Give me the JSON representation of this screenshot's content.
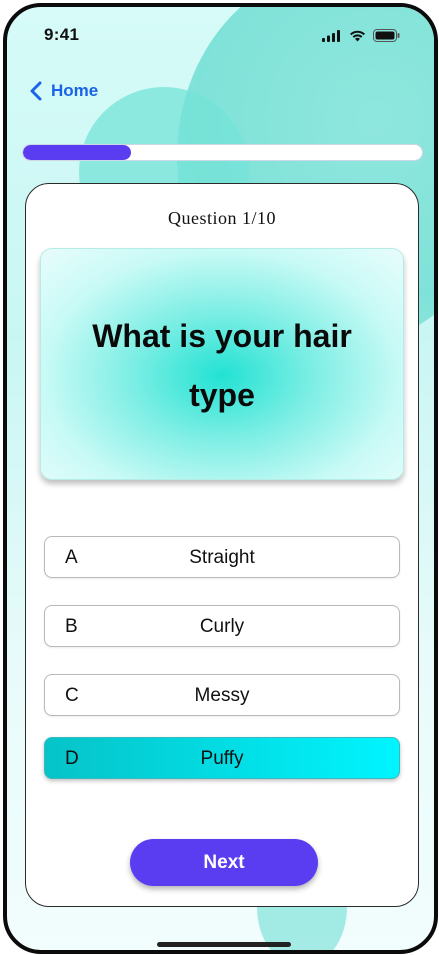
{
  "status_bar": {
    "time": "9:41",
    "icons": [
      "signal-icon",
      "wifi-icon",
      "battery-icon"
    ]
  },
  "nav": {
    "back_label": "Home",
    "back_icon": "chevron-left-icon"
  },
  "progress": {
    "fraction": 0.27
  },
  "quiz": {
    "counter": "Question 1/10",
    "question": "What is your hair type",
    "options": [
      {
        "letter": "A",
        "label": "Straight",
        "selected": false
      },
      {
        "letter": "B",
        "label": "Curly",
        "selected": false
      },
      {
        "letter": "C",
        "label": "Messy",
        "selected": false
      },
      {
        "letter": "D",
        "label": "Puffy",
        "selected": true
      }
    ],
    "next_label": "Next"
  },
  "colors": {
    "accent": "#5a3df0",
    "link": "#1a63e8",
    "selected_start": "#06c3c8",
    "selected_end": "#00f5ff"
  }
}
